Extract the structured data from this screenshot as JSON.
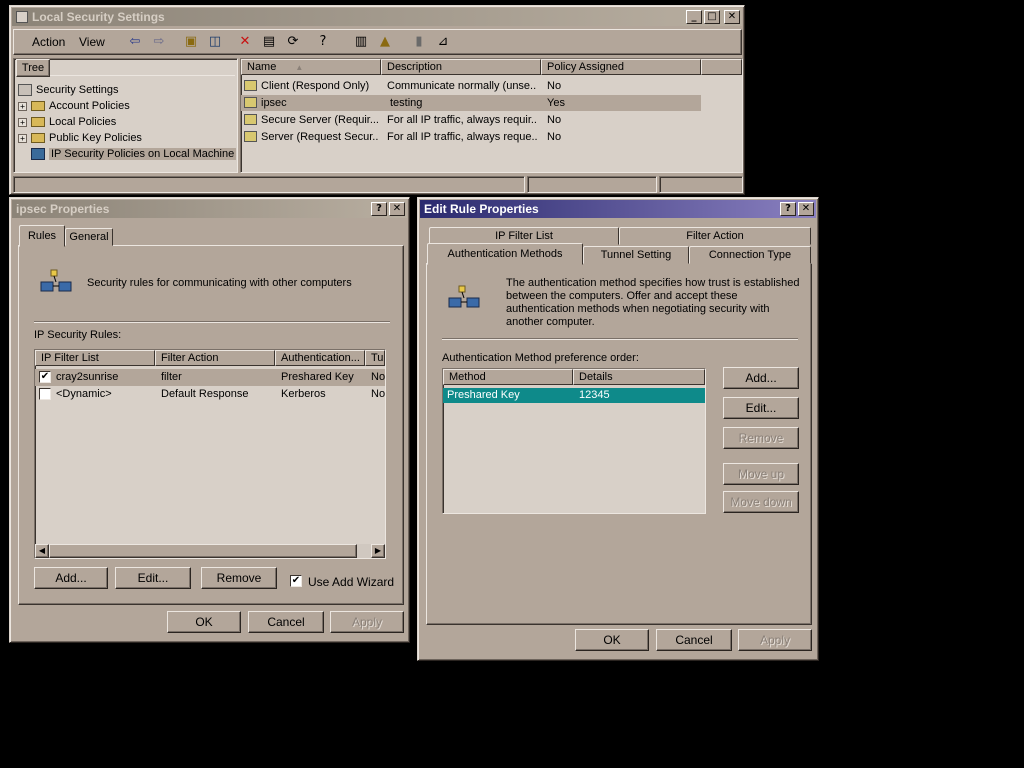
{
  "mmc": {
    "title": "Local Security Settings",
    "menu": {
      "action": "Action",
      "view": "View"
    },
    "tree_tab": "Tree",
    "tree": [
      "Security Settings",
      "Account Policies",
      "Local Policies",
      "Public Key Policies",
      "IP Security Policies on Local Machine"
    ],
    "columns": {
      "name": "Name",
      "sort_icon": "▲",
      "description": "Description",
      "policy_assigned": "Policy Assigned"
    },
    "rows": [
      {
        "name": "Client (Respond Only)",
        "description": "Communicate normally (unse...",
        "assigned": "No"
      },
      {
        "name": "ipsec",
        "description": "testing",
        "assigned": "Yes"
      },
      {
        "name": "Secure Server (Requir...",
        "description": "For all IP traffic, always requir...",
        "assigned": "No"
      },
      {
        "name": "Server (Request Secur...",
        "description": "For all IP traffic, always reque...",
        "assigned": "No"
      }
    ]
  },
  "ipsec_props": {
    "title": "ipsec Properties",
    "tabs": {
      "rules": "Rules",
      "general": "General"
    },
    "intro": "Security rules for communicating with other computers",
    "rules_label": "IP Security Rules:",
    "columns": {
      "filter_list": "IP Filter List",
      "filter_action": "Filter Action",
      "auth": "Authentication...",
      "tunnel": "Tu"
    },
    "rows": [
      {
        "checked": "✔",
        "filter_list": "cray2sunrise",
        "filter_action": "filter",
        "auth": "Preshared Key",
        "tunnel": "No"
      },
      {
        "checked": "",
        "filter_list": "<Dynamic>",
        "filter_action": "Default Response",
        "auth": "Kerberos",
        "tunnel": "No"
      }
    ],
    "buttons": {
      "add": "Add...",
      "edit": "Edit...",
      "remove": "Remove",
      "ok": "OK",
      "cancel": "Cancel",
      "apply": "Apply"
    },
    "wizard_check": "✔",
    "wizard_label": "Use Add Wizard"
  },
  "edit_rule": {
    "title": "Edit Rule Properties",
    "tabs": {
      "ip_filter_list": "IP Filter List",
      "filter_action": "Filter Action",
      "auth_methods": "Authentication Methods",
      "tunnel_setting": "Tunnel Setting",
      "connection_type": "Connection Type"
    },
    "intro": "The authentication method specifies how trust is established between the computers. Offer and accept these authentication methods when negotiating security with another computer.",
    "pref_label": "Authentication Method preference order:",
    "columns": {
      "method": "Method",
      "details": "Details"
    },
    "rows": [
      {
        "method": "Preshared Key",
        "details": "12345"
      }
    ],
    "buttons": {
      "add": "Add...",
      "edit": "Edit...",
      "remove": "Remove",
      "move_up": "Move up",
      "move_down": "Move down",
      "ok": "OK",
      "cancel": "Cancel",
      "apply": "Apply"
    }
  },
  "titlebar_buttons": {
    "help": "?",
    "close": "✕",
    "minimize": "_",
    "maximize": "□"
  },
  "colors": {
    "selection": "#0e8a8a",
    "window_face": "#b3a69a",
    "desktop": "#000000"
  }
}
